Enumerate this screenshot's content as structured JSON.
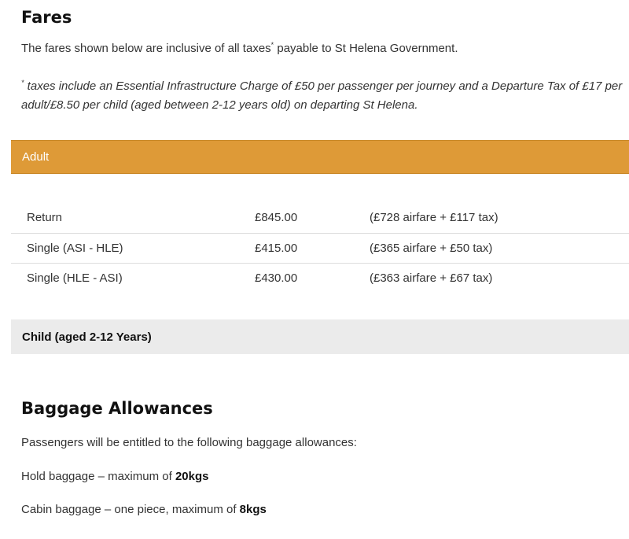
{
  "fares": {
    "title": "Fares",
    "intro": "The fares shown below are inclusive of all taxes",
    "intro_marker": "*",
    "intro_end": " payable to St Helena Government.",
    "tax_note_marker": "*",
    "tax_note": " taxes include an Essential Infrastructure Charge of £50 per passenger per journey and a Departure Tax of £17 per adult/£8.50 per child (aged between 2-12 years old) on departing St Helena.",
    "adult": {
      "heading": "Adult",
      "rows": [
        {
          "type": "Return",
          "price": "£845.00",
          "breakdown": "(£728 airfare + £117 tax)"
        },
        {
          "type": "Single (ASI - HLE)",
          "price": "£415.00",
          "breakdown": "(£365 airfare + £50 tax)"
        },
        {
          "type": "Single (HLE - ASI)",
          "price": "£430.00",
          "breakdown": "(£363 airfare + £67 tax)"
        }
      ]
    },
    "child": {
      "heading": "Child (aged 2-12 Years)"
    }
  },
  "baggage": {
    "title": "Baggage Allowances",
    "intro": "Passengers will be entitled to the following baggage allowances:",
    "hold_prefix": "Hold baggage – maximum of ",
    "hold_value": "20kgs",
    "cabin_prefix": "Cabin baggage – one piece, maximum of ",
    "cabin_value": "8kgs"
  },
  "colors": {
    "accent": "#de9a37",
    "collapsed_header": "#ebebeb"
  }
}
